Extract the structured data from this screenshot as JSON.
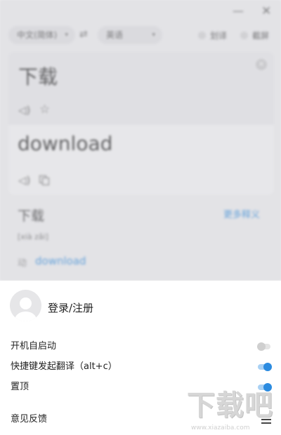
{
  "window": {
    "minimize_glyph": "—",
    "close_glyph": "✕"
  },
  "languages": {
    "source": "中文(简体)",
    "target": "英语",
    "caret": "▾",
    "swap_glyph": "⇄"
  },
  "options": {
    "word_pick": "划译",
    "screenshot": "截屏"
  },
  "input": {
    "text": "下载",
    "clear_glyph": "✕",
    "speaker_glyph": "◁)",
    "star_glyph": "☆"
  },
  "output": {
    "text": "download",
    "speaker_glyph": "◁)"
  },
  "dictionary": {
    "word": "下载",
    "more_link": "更多释义",
    "pinyin": "[xià zǎi]",
    "part_of_speech": "动",
    "definition": "download"
  },
  "settings": {
    "login_label": "登录/注册",
    "items": [
      {
        "label": "开机自启动",
        "enabled": false
      },
      {
        "label": "快捷键发起翻译（alt+c）",
        "enabled": true
      },
      {
        "label": "置顶",
        "enabled": true
      }
    ],
    "feedback_label": "意见反馈"
  },
  "watermark": {
    "logo": "下载吧",
    "url": "www.xiazaiba.com"
  },
  "colors": {
    "accent": "#2b8be0",
    "toggle_off": "#cfcfcf"
  },
  "icons": [
    "minimize-icon",
    "close-icon",
    "swap-icon",
    "clear-icon",
    "speaker-icon",
    "star-icon",
    "copy-icon",
    "avatar-icon",
    "menu-icon"
  ]
}
